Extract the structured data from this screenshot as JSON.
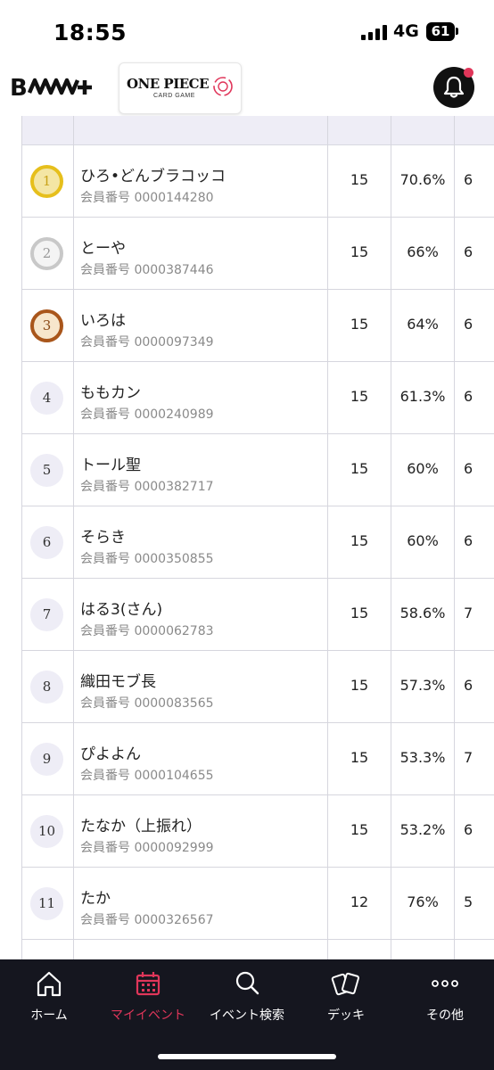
{
  "status_bar": {
    "time": "18:55",
    "network": "4G",
    "battery": "61"
  },
  "header": {
    "brand_logo": "B(ロゴ)+",
    "game_logo_title": "ONE PIECE",
    "game_logo_subtitle": "CARD GAME",
    "notification_icon": "bell-icon",
    "notification_dot_color": "#e0365a"
  },
  "ranking": [
    {
      "rank": "1",
      "name": "ひろ•どんブラコッコ",
      "member_no": "会員番号 0000144280",
      "games": "15",
      "rate": "70.6%",
      "extra": "6"
    },
    {
      "rank": "2",
      "name": "とーや",
      "member_no": "会員番号 0000387446",
      "games": "15",
      "rate": "66%",
      "extra": "6"
    },
    {
      "rank": "3",
      "name": "いろは",
      "member_no": "会員番号 0000097349",
      "games": "15",
      "rate": "64%",
      "extra": "6"
    },
    {
      "rank": "4",
      "name": "ももカン",
      "member_no": "会員番号 0000240989",
      "games": "15",
      "rate": "61.3%",
      "extra": "6"
    },
    {
      "rank": "5",
      "name": "トール聖",
      "member_no": "会員番号 0000382717",
      "games": "15",
      "rate": "60%",
      "extra": "6"
    },
    {
      "rank": "6",
      "name": "そらき",
      "member_no": "会員番号 0000350855",
      "games": "15",
      "rate": "60%",
      "extra": "6"
    },
    {
      "rank": "7",
      "name": "はる3(さん)",
      "member_no": "会員番号 0000062783",
      "games": "15",
      "rate": "58.6%",
      "extra": "7"
    },
    {
      "rank": "8",
      "name": "織田モブ長",
      "member_no": "会員番号 0000083565",
      "games": "15",
      "rate": "57.3%",
      "extra": "6"
    },
    {
      "rank": "9",
      "name": "ぴよよん",
      "member_no": "会員番号 0000104655",
      "games": "15",
      "rate": "53.3%",
      "extra": "7"
    },
    {
      "rank": "10",
      "name": "たなか（上振れ）",
      "member_no": "会員番号 0000092999",
      "games": "15",
      "rate": "53.2%",
      "extra": "6"
    },
    {
      "rank": "11",
      "name": "たか",
      "member_no": "会員番号 0000326567",
      "games": "12",
      "rate": "76%",
      "extra": "5"
    }
  ],
  "tab_bar": {
    "home": "ホーム",
    "my_events": "マイイベント",
    "event_search": "イベント検索",
    "deck": "デッキ",
    "more": "その他",
    "active_tab": "my_events",
    "active_color": "#e0365a"
  }
}
